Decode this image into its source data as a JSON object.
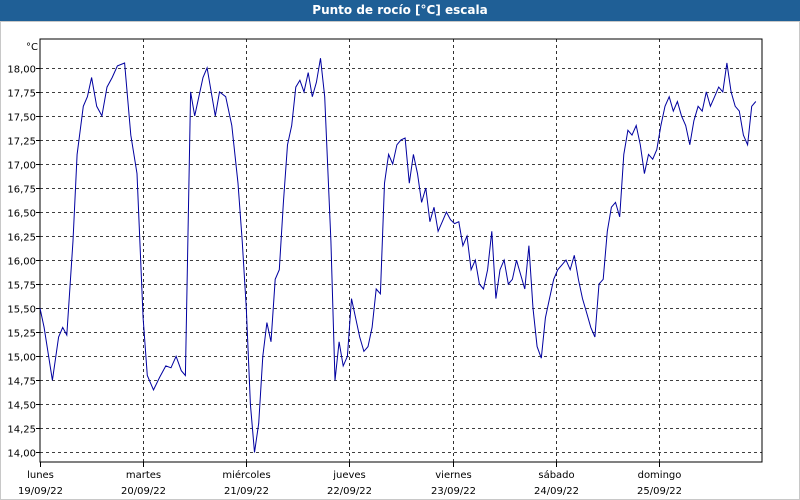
{
  "title": "Punto de rocío [°C] escala",
  "chart_data": {
    "type": "line",
    "title": "Punto de rocío [°C] escala",
    "y_unit": "°C",
    "ylim": [
      13.9,
      18.3
    ],
    "yticks": [
      "18,00",
      "17,75",
      "17,50",
      "17,25",
      "17,00",
      "16,75",
      "16,50",
      "16,25",
      "16,00",
      "15,75",
      "15,50",
      "15,25",
      "15,00",
      "14,75",
      "14,50",
      "14,25",
      "14,00"
    ],
    "ytick_values": [
      18.0,
      17.75,
      17.5,
      17.25,
      17.0,
      16.75,
      16.5,
      16.25,
      16.0,
      15.75,
      15.5,
      15.25,
      15.0,
      14.75,
      14.5,
      14.25,
      14.0
    ],
    "days": [
      {
        "day": "lunes",
        "date": "19/09/22"
      },
      {
        "day": "martes",
        "date": "20/09/22"
      },
      {
        "day": "miércoles",
        "date": "21/09/22"
      },
      {
        "day": "jueves",
        "date": "22/09/22"
      },
      {
        "day": "viernes",
        "date": "23/09/22"
      },
      {
        "day": "sábado",
        "date": "24/09/22"
      },
      {
        "day": "domingo",
        "date": "25/09/22"
      }
    ],
    "grid": true,
    "series_color": "#0000a0",
    "x_days": [
      0,
      0.04,
      0.12,
      0.18,
      0.22,
      0.26,
      0.32,
      0.36,
      0.42,
      0.46,
      0.5,
      0.55,
      0.6,
      0.65,
      0.7,
      0.75,
      0.82,
      0.88,
      0.94,
      1.0,
      1.04,
      1.1,
      1.16,
      1.22,
      1.27,
      1.32,
      1.37,
      1.41,
      1.46,
      1.5,
      1.55,
      1.58,
      1.62,
      1.66,
      1.7,
      1.74,
      1.8,
      1.86,
      1.92,
      1.96,
      2.0,
      2.04,
      2.08,
      2.12,
      2.16,
      2.2,
      2.24,
      2.28,
      2.32,
      2.36,
      2.4,
      2.44,
      2.48,
      2.52,
      2.56,
      2.6,
      2.64,
      2.68,
      2.72,
      2.76,
      2.82,
      2.86,
      2.9,
      2.94,
      2.98,
      3.02,
      3.06,
      3.1,
      3.14,
      3.18,
      3.22,
      3.26,
      3.3,
      3.34,
      3.38,
      3.42,
      3.46,
      3.5,
      3.54,
      3.58,
      3.62,
      3.66,
      3.7,
      3.74,
      3.78,
      3.82,
      3.86,
      3.9,
      3.94,
      3.98,
      4.02,
      4.06,
      4.1,
      4.14,
      4.18,
      4.22,
      4.26,
      4.3,
      4.34,
      4.38,
      4.42,
      4.46,
      4.5,
      4.54,
      4.58,
      4.62,
      4.66,
      4.7,
      4.74,
      4.78,
      4.82,
      4.86,
      4.9,
      4.94,
      4.98,
      5.02,
      5.06,
      5.1,
      5.14,
      5.18,
      5.22,
      5.26,
      5.3,
      5.34,
      5.38,
      5.42,
      5.46,
      5.5,
      5.54,
      5.58,
      5.62,
      5.66,
      5.7,
      5.74,
      5.78,
      5.82,
      5.86,
      5.9,
      5.94,
      5.98,
      6.02,
      6.06,
      6.1,
      6.14,
      6.18,
      6.22,
      6.26,
      6.3,
      6.34,
      6.38,
      6.42,
      6.46,
      6.5,
      6.54,
      6.58,
      6.62,
      6.66,
      6.7,
      6.74,
      6.78,
      6.82,
      6.86,
      6.9,
      6.94
    ],
    "y": [
      15.5,
      15.3,
      14.75,
      15.2,
      15.3,
      15.22,
      16.2,
      17.1,
      17.6,
      17.7,
      17.9,
      17.6,
      17.5,
      17.8,
      17.9,
      18.02,
      18.05,
      17.3,
      16.9,
      15.4,
      14.8,
      14.65,
      14.78,
      14.9,
      14.88,
      15.0,
      14.85,
      14.8,
      17.75,
      17.5,
      17.75,
      17.9,
      18.0,
      17.75,
      17.5,
      17.75,
      17.7,
      17.4,
      16.8,
      16.2,
      15.5,
      14.5,
      14.0,
      14.3,
      15.0,
      15.35,
      15.15,
      15.8,
      15.9,
      16.6,
      17.2,
      17.4,
      17.8,
      17.87,
      17.75,
      17.95,
      17.7,
      17.85,
      18.1,
      17.7,
      16.2,
      14.75,
      15.15,
      14.9,
      15.0,
      15.6,
      15.4,
      15.2,
      15.05,
      15.1,
      15.3,
      15.7,
      15.65,
      16.8,
      17.1,
      17.0,
      17.2,
      17.25,
      17.27,
      16.8,
      17.1,
      16.9,
      16.6,
      16.75,
      16.4,
      16.55,
      16.3,
      16.4,
      16.5,
      16.42,
      16.38,
      16.4,
      16.15,
      16.25,
      15.9,
      16.0,
      15.75,
      15.7,
      15.9,
      16.3,
      15.6,
      15.9,
      16.0,
      15.75,
      15.8,
      16.0,
      15.85,
      15.7,
      16.15,
      15.5,
      15.1,
      14.98,
      15.4,
      15.6,
      15.8,
      15.9,
      15.95,
      16.0,
      15.9,
      16.05,
      15.8,
      15.6,
      15.45,
      15.3,
      15.2,
      15.75,
      15.8,
      16.3,
      16.55,
      16.6,
      16.45,
      17.1,
      17.35,
      17.3,
      17.4,
      17.2,
      16.9,
      17.1,
      17.05,
      17.15,
      17.4,
      17.6,
      17.7,
      17.55,
      17.65,
      17.5,
      17.4,
      17.2,
      17.45,
      17.6,
      17.55,
      17.75,
      17.6,
      17.7,
      17.8,
      17.75,
      18.05,
      17.75,
      17.6,
      17.55,
      17.3,
      17.2,
      17.6,
      17.65,
      17.4,
      17.1
    ]
  }
}
